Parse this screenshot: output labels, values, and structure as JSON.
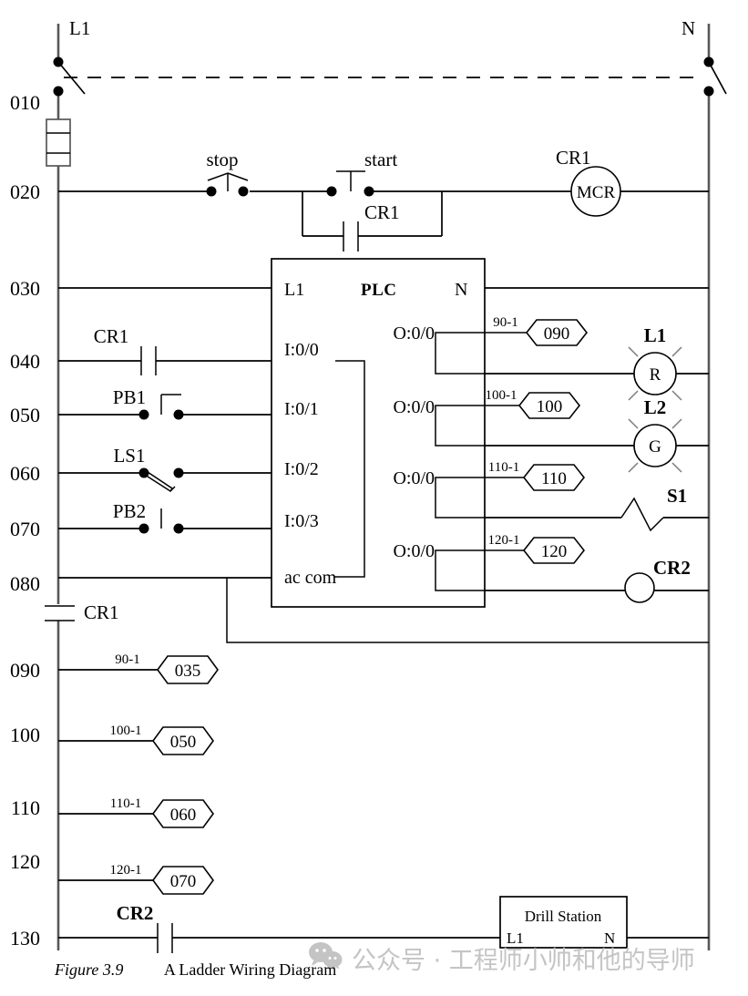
{
  "figure": {
    "number": "Figure 3.9",
    "title": "A Ladder Wiring Diagram"
  },
  "watermark": {
    "text": "公众号 · 工程师小帅和他的导师",
    "logo": "wechat-logo",
    "color": "#c4c4c4"
  },
  "rails": {
    "left_label": "L1",
    "right_label": "N"
  },
  "rungs": [
    {
      "number": "010"
    },
    {
      "number": "020"
    },
    {
      "number": "030"
    },
    {
      "number": "040"
    },
    {
      "number": "050"
    },
    {
      "number": "060"
    },
    {
      "number": "070"
    },
    {
      "number": "080"
    },
    {
      "number": "090"
    },
    {
      "number": "100"
    },
    {
      "number": "110"
    },
    {
      "number": "120"
    },
    {
      "number": "130"
    }
  ],
  "power_rung": {
    "stop_label": "stop",
    "start_label": "start",
    "sealin_label": "CR1",
    "coil_relay_label": "CR1",
    "coil_text": "MCR"
  },
  "plc": {
    "title": "PLC",
    "left_terminal": "L1",
    "right_terminal": "N",
    "inputs": [
      {
        "terminal": "I:0/0"
      },
      {
        "terminal": "I:0/1"
      },
      {
        "terminal": "I:0/2"
      },
      {
        "terminal": "I:0/3"
      }
    ],
    "common": "ac com",
    "outputs": [
      {
        "terminal": "O:0/0"
      },
      {
        "terminal": "O:0/0"
      },
      {
        "terminal": "O:0/0"
      },
      {
        "terminal": "O:0/0"
      }
    ]
  },
  "input_devices": [
    {
      "name": "CR1",
      "type": "contact-no"
    },
    {
      "name": "PB1",
      "type": "pushbutton-no"
    },
    {
      "name": "LS1",
      "type": "limit-switch"
    },
    {
      "name": "PB2",
      "type": "pushbutton-no"
    }
  ],
  "rail_contact": {
    "name": "CR1"
  },
  "output_wire_tags": [
    {
      "wire": "90-1",
      "tag": "090"
    },
    {
      "wire": "100-1",
      "tag": "100"
    },
    {
      "wire": "110-1",
      "tag": "110"
    },
    {
      "wire": "120-1",
      "tag": "120"
    }
  ],
  "lower_wire_tags": [
    {
      "wire": "90-1",
      "tag": "035"
    },
    {
      "wire": "100-1",
      "tag": "050"
    },
    {
      "wire": "110-1",
      "tag": "060"
    },
    {
      "wire": "120-1",
      "tag": "070"
    }
  ],
  "loads": [
    {
      "name": "L1",
      "letter": "R",
      "type": "lamp"
    },
    {
      "name": "L2",
      "letter": "G",
      "type": "lamp"
    },
    {
      "name": "S1",
      "type": "solenoid"
    },
    {
      "name": "CR2",
      "type": "coil"
    }
  ],
  "bottom_contact": {
    "name": "CR2"
  },
  "drill_station": {
    "title": "Drill Station",
    "left_terminal": "L1",
    "right_terminal": "N"
  }
}
